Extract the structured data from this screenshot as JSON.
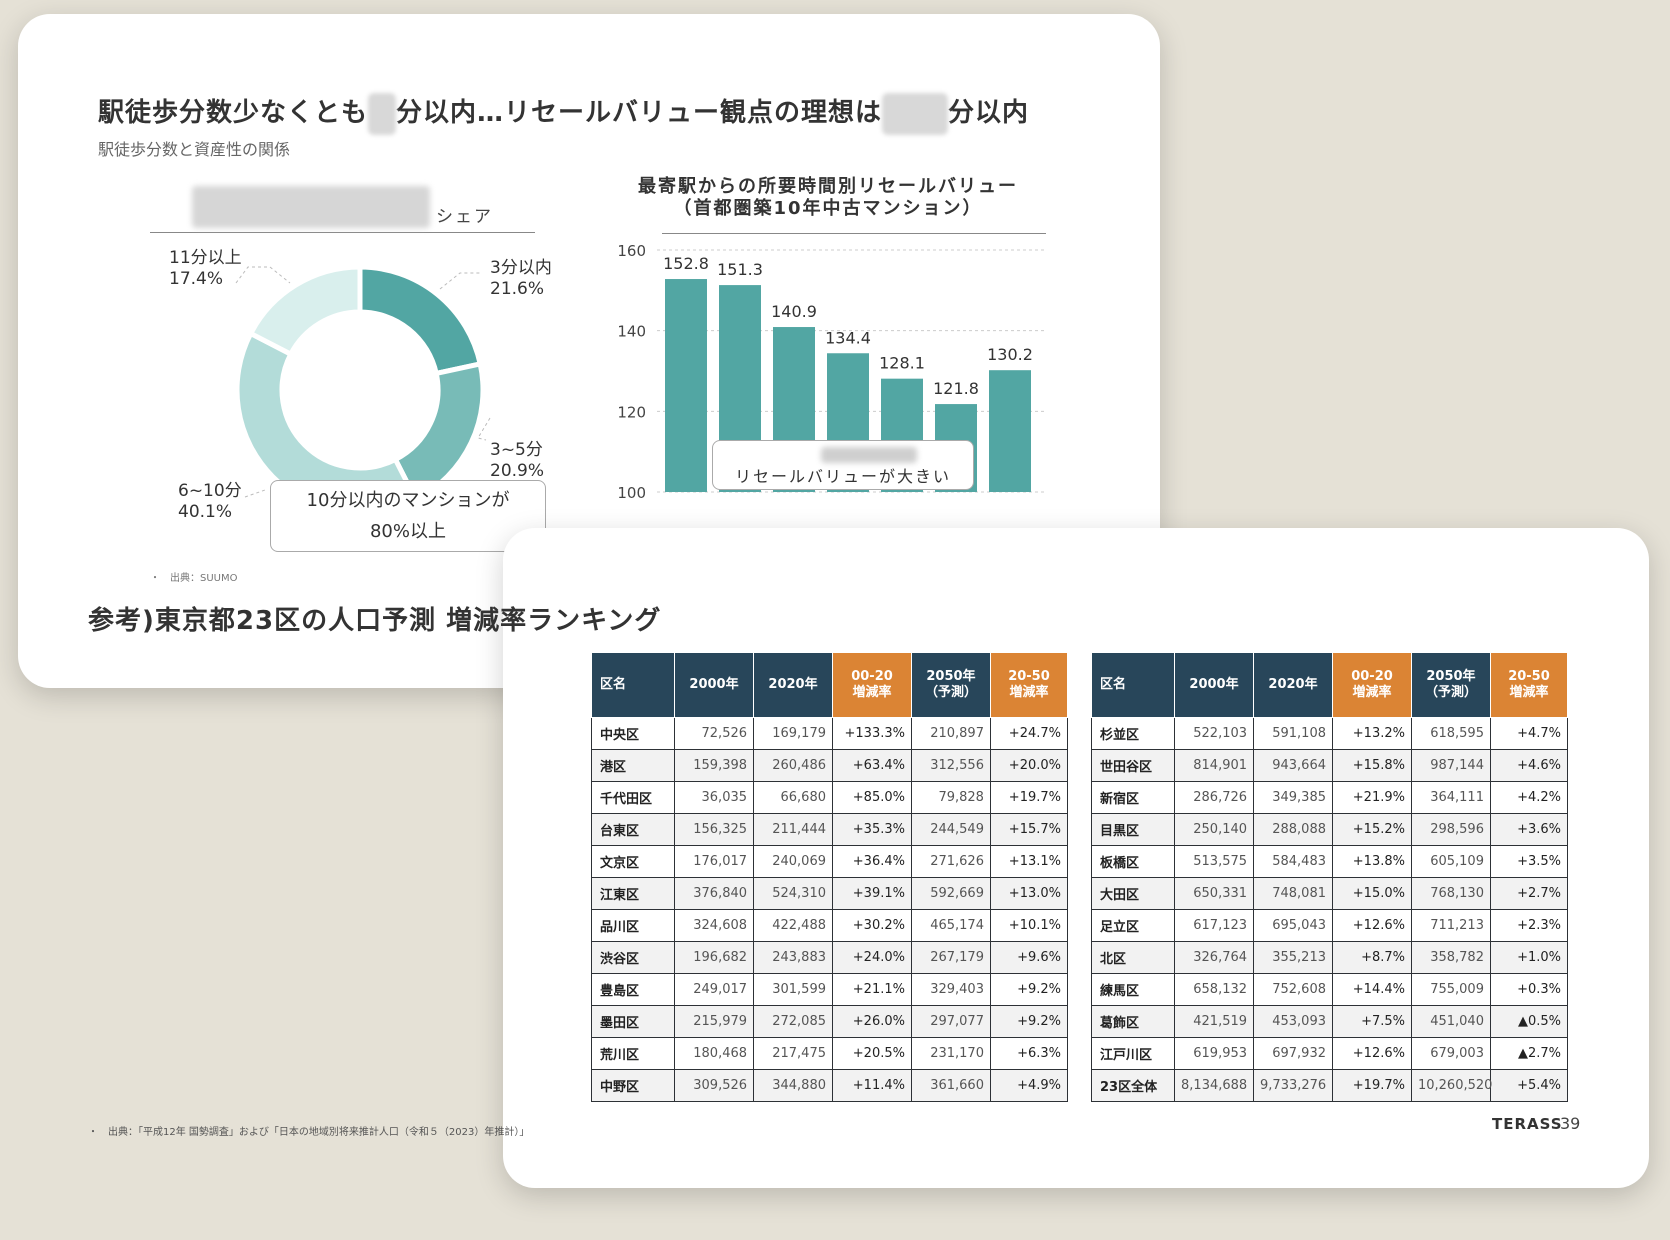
{
  "slide1": {
    "title_part1": "駅徒歩分数少なくとも",
    "title_part2": "分以内…リセールバリュー観点の理想は",
    "title_part3": "分以内",
    "subtitle": "駅徒歩分数と資産性の関係",
    "donut_header_suffix": "シェア",
    "donut_labels": [
      {
        "text": "3分以内",
        "value": "21.6%"
      },
      {
        "text": "3~5分",
        "value": "20.9%"
      },
      {
        "text": "6~10分",
        "value": "40.1%"
      },
      {
        "text": "11分以上",
        "value": "17.4%"
      }
    ],
    "callout_line1": "10分以内のマンションが",
    "callout_line2": "80%以上",
    "bar_title_line1": "最寄駅からの所要時間別リセールバリュー",
    "bar_title_line2": "（首都圏築10年中古マンション）",
    "bar_callout": "リセールバリューが大きい",
    "source": "・　出典：SUUMO"
  },
  "colors": {
    "teal_dark": "#52a6a3",
    "teal_mid": "#78bbb7",
    "teal_light": "#b3dcd9",
    "teal_pale": "#d9efed",
    "header_dark": "#28465a",
    "header_orange": "#db8434"
  },
  "chart_data": [
    {
      "type": "pie",
      "categories": [
        "3分以内",
        "3~5分",
        "6~10分",
        "11分以上"
      ],
      "values": [
        21.6,
        20.9,
        40.1,
        17.4
      ],
      "title": "シェア",
      "style": "donut"
    },
    {
      "type": "bar",
      "title": "最寄駅からの所要時間別リセールバリュー（首都圏築10年中古マンション）",
      "categories": [
        "",
        "",
        "",
        "",
        "",
        "",
        ""
      ],
      "values": [
        152.8,
        151.3,
        140.9,
        134.4,
        128.1,
        121.8,
        130.2
      ],
      "ylim": [
        100,
        160
      ],
      "yticks": [
        100,
        120,
        140,
        160
      ],
      "grid": "horizontal dotted"
    }
  ],
  "slide2": {
    "title": "参考)東京都23区の人口予測 増減率ランキング",
    "headers": [
      "区名",
      "2000年",
      "2020年",
      "00-20\n増減率",
      "2050年\n（予測）",
      "20-50\n増減率"
    ],
    "left_rows": [
      [
        "中央区",
        "72,526",
        "169,179",
        "+133.3%",
        "210,897",
        "+24.7%"
      ],
      [
        "港区",
        "159,398",
        "260,486",
        "+63.4%",
        "312,556",
        "+20.0%"
      ],
      [
        "千代田区",
        "36,035",
        "66,680",
        "+85.0%",
        "79,828",
        "+19.7%"
      ],
      [
        "台東区",
        "156,325",
        "211,444",
        "+35.3%",
        "244,549",
        "+15.7%"
      ],
      [
        "文京区",
        "176,017",
        "240,069",
        "+36.4%",
        "271,626",
        "+13.1%"
      ],
      [
        "江東区",
        "376,840",
        "524,310",
        "+39.1%",
        "592,669",
        "+13.0%"
      ],
      [
        "品川区",
        "324,608",
        "422,488",
        "+30.2%",
        "465,174",
        "+10.1%"
      ],
      [
        "渋谷区",
        "196,682",
        "243,883",
        "+24.0%",
        "267,179",
        "+9.6%"
      ],
      [
        "豊島区",
        "249,017",
        "301,599",
        "+21.1%",
        "329,403",
        "+9.2%"
      ],
      [
        "墨田区",
        "215,979",
        "272,085",
        "+26.0%",
        "297,077",
        "+9.2%"
      ],
      [
        "荒川区",
        "180,468",
        "217,475",
        "+20.5%",
        "231,170",
        "+6.3%"
      ],
      [
        "中野区",
        "309,526",
        "344,880",
        "+11.4%",
        "361,660",
        "+4.9%"
      ]
    ],
    "right_rows": [
      [
        "杉並区",
        "522,103",
        "591,108",
        "+13.2%",
        "618,595",
        "+4.7%"
      ],
      [
        "世田谷区",
        "814,901",
        "943,664",
        "+15.8%",
        "987,144",
        "+4.6%"
      ],
      [
        "新宿区",
        "286,726",
        "349,385",
        "+21.9%",
        "364,111",
        "+4.2%"
      ],
      [
        "目黒区",
        "250,140",
        "288,088",
        "+15.2%",
        "298,596",
        "+3.6%"
      ],
      [
        "板橋区",
        "513,575",
        "584,483",
        "+13.8%",
        "605,109",
        "+3.5%"
      ],
      [
        "大田区",
        "650,331",
        "748,081",
        "+15.0%",
        "768,130",
        "+2.7%"
      ],
      [
        "足立区",
        "617,123",
        "695,043",
        "+12.6%",
        "711,213",
        "+2.3%"
      ],
      [
        "北区",
        "326,764",
        "355,213",
        "+8.7%",
        "358,782",
        "+1.0%"
      ],
      [
        "練馬区",
        "658,132",
        "752,608",
        "+14.4%",
        "755,009",
        "+0.3%"
      ],
      [
        "葛飾区",
        "421,519",
        "453,093",
        "+7.5%",
        "451,040",
        "▲0.5%"
      ],
      [
        "江戸川区",
        "619,953",
        "697,932",
        "+12.6%",
        "679,003",
        "▲2.7%"
      ],
      [
        "23区全体",
        "8,134,688",
        "9,733,276",
        "+19.7%",
        "10,260,520",
        "+5.4%"
      ]
    ],
    "source": "・　出典：「平成12年 国勢調査」および「日本の地域別将来推計人口（令和５（2023）年推計）」",
    "logo": "TERASS",
    "page": "39"
  }
}
